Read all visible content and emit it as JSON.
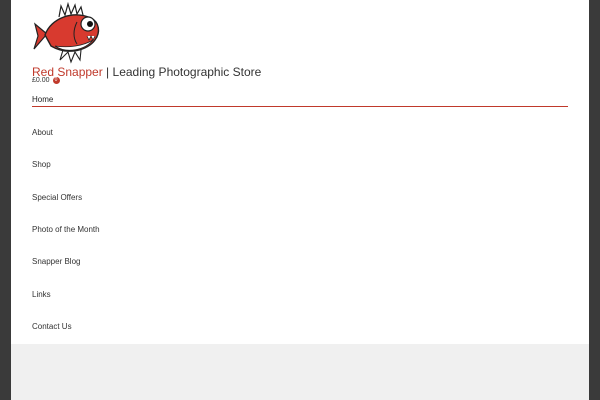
{
  "site": {
    "brand": "Red Snapper",
    "separator": " | ",
    "tagline": "Leading Photographic Store",
    "logo_icon": "red-snapper-fish-icon"
  },
  "cart": {
    "total": "£0.00",
    "count": "0"
  },
  "nav": {
    "active": "Home",
    "items": [
      "About",
      "Shop",
      "Special Offers",
      "Photo of the Month",
      "Snapper Blog",
      "Links",
      "Contact Us"
    ]
  },
  "colors": {
    "accent": "#c0392b",
    "background": "#3a3a3a",
    "page": "#ffffff"
  }
}
